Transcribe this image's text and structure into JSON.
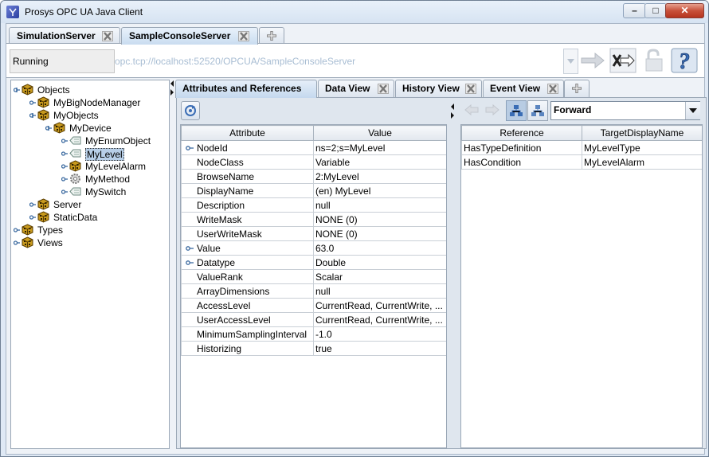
{
  "window": {
    "title": "Prosys OPC UA Java Client"
  },
  "server_tabs": [
    {
      "label": "SimulationServer"
    },
    {
      "label": "SampleConsoleServer"
    }
  ],
  "connection": {
    "status": "Running",
    "url": "opc.tcp://localhost:52520/OPCUA/SampleConsoleServer"
  },
  "tree": {
    "nodes": [
      {
        "label": "Objects"
      },
      {
        "label": "MyBigNodeManager"
      },
      {
        "label": "MyObjects"
      },
      {
        "label": "MyDevice"
      },
      {
        "label": "MyEnumObject"
      },
      {
        "label": "MyLevel"
      },
      {
        "label": "MyLevelAlarm"
      },
      {
        "label": "MyMethod"
      },
      {
        "label": "MySwitch"
      },
      {
        "label": "Server"
      },
      {
        "label": "StaticData"
      },
      {
        "label": "Types"
      },
      {
        "label": "Views"
      }
    ],
    "selected": "MyLevel"
  },
  "view_tabs": [
    {
      "label": "Attributes and References"
    },
    {
      "label": "Data View"
    },
    {
      "label": "History View"
    },
    {
      "label": "Event View"
    }
  ],
  "attributes": {
    "columns": [
      "Attribute",
      "Value"
    ],
    "rows": [
      {
        "attribute": "NodeId",
        "value": "ns=2;s=MyLevel",
        "expandable": true
      },
      {
        "attribute": "NodeClass",
        "value": "Variable",
        "expandable": false
      },
      {
        "attribute": "BrowseName",
        "value": "2:MyLevel",
        "expandable": false
      },
      {
        "attribute": "DisplayName",
        "value": "(en) MyLevel",
        "expandable": false
      },
      {
        "attribute": "Description",
        "value": "null",
        "expandable": false
      },
      {
        "attribute": "WriteMask",
        "value": "NONE  (0)",
        "expandable": false
      },
      {
        "attribute": "UserWriteMask",
        "value": "NONE  (0)",
        "expandable": false
      },
      {
        "attribute": "Value",
        "value": "63.0",
        "expandable": true
      },
      {
        "attribute": "Datatype",
        "value": "Double",
        "expandable": true
      },
      {
        "attribute": "ValueRank",
        "value": "Scalar",
        "expandable": false
      },
      {
        "attribute": "ArrayDimensions",
        "value": "null",
        "expandable": false
      },
      {
        "attribute": "AccessLevel",
        "value": "CurrentRead, CurrentWrite, ...",
        "expandable": false
      },
      {
        "attribute": "UserAccessLevel",
        "value": "CurrentRead, CurrentWrite, ...",
        "expandable": false
      },
      {
        "attribute": "MinimumSamplingInterval",
        "value": "-1.0",
        "expandable": false
      },
      {
        "attribute": "Historizing",
        "value": "true",
        "expandable": false
      }
    ]
  },
  "references": {
    "direction": "Forward",
    "columns": [
      "Reference",
      "TargetDisplayName"
    ],
    "rows": [
      {
        "reference": "HasTypeDefinition",
        "target": "MyLevelType"
      },
      {
        "reference": "HasCondition",
        "target": "MyLevelAlarm"
      }
    ]
  },
  "icons": {
    "object": "cube-object-icon",
    "variable": "variable-tag-icon",
    "method": "gear-method-icon",
    "close_tab": "close-tab-icon",
    "add_tab": "add-tab-icon"
  },
  "colors": {
    "accent": "#b8cfe8",
    "url_text": "#a8bdd3",
    "close_button": "#c8513a"
  }
}
